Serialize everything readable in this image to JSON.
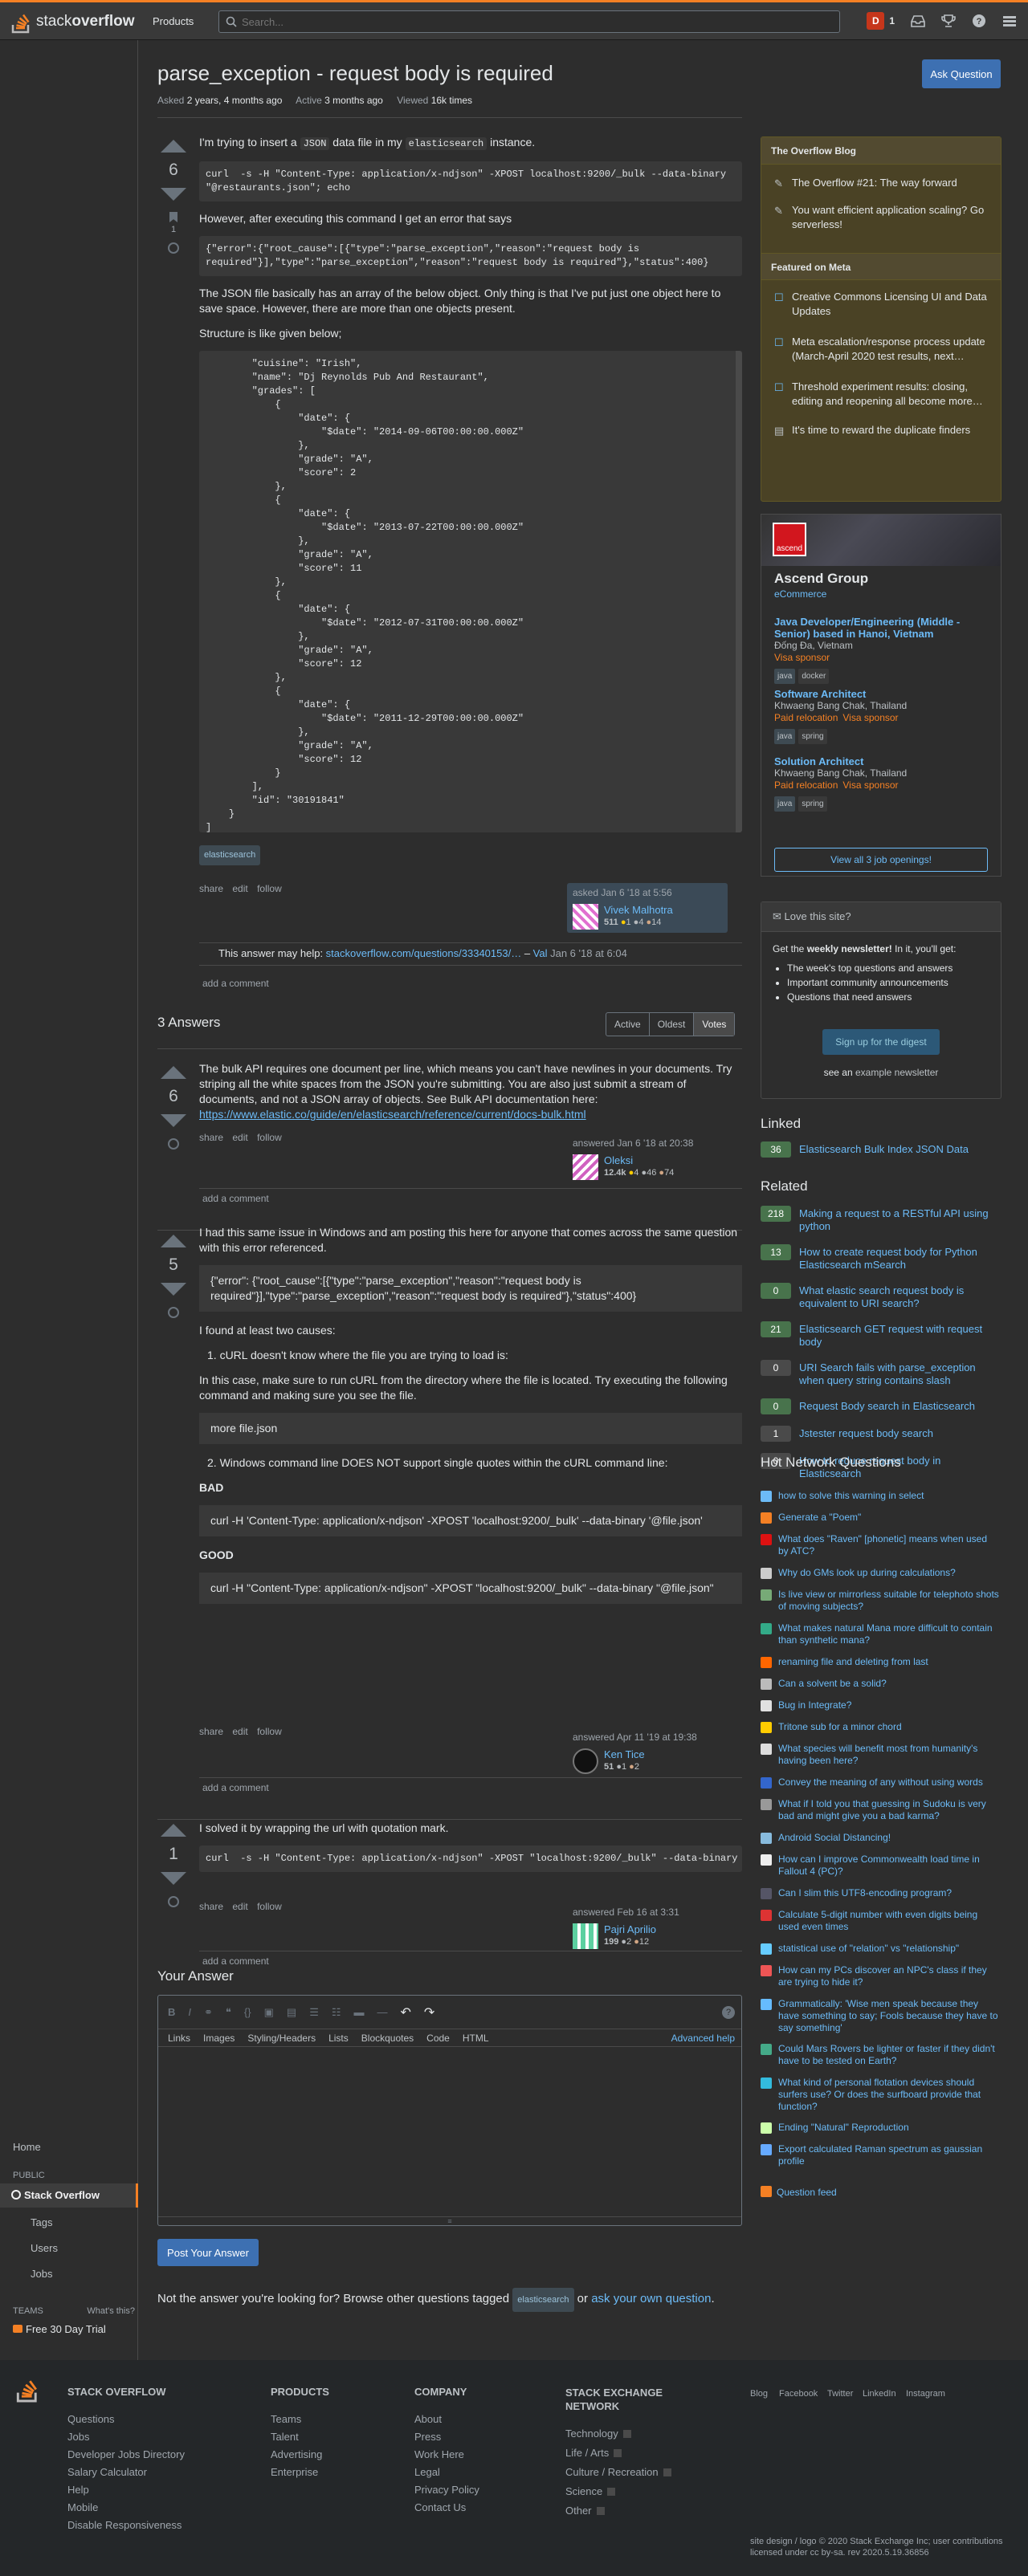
{
  "header": {
    "logo_text_a": "stack",
    "logo_text_b": "overflow",
    "products": "Products",
    "search_placeholder": "Search...",
    "user_initial": "D",
    "user_rep": "1"
  },
  "leftnav": {
    "home": "Home",
    "public": "PUBLIC",
    "stack_overflow": "Stack Overflow",
    "tags": "Tags",
    "users": "Users",
    "jobs": "Jobs",
    "teams": "TEAMS",
    "whats_this": "What's this?",
    "free_trial": "Free 30 Day Trial"
  },
  "question": {
    "title": "parse_exception - request body is required",
    "ask_button": "Ask Question",
    "asked_label": "Asked",
    "asked_value": "2 years, 4 months ago",
    "active_label": "Active",
    "active_value": "3 months ago",
    "viewed_label": "Viewed",
    "viewed_value": "16k times",
    "votes": "6",
    "bookmarks": "1",
    "p1_a": "I'm trying to insert a ",
    "p1_code": "JSON",
    "p1_b": " data file in my ",
    "p1_code2": "elasticsearch",
    "p1_c": " instance.",
    "cmd": "curl  -s -H \"Content-Type: application/x-ndjson\" -XPOST localhost:9200/_bulk --data-binary \"@restaurants.json\"; echo",
    "p2": "However, after executing this command I get an error that says",
    "err": "{\"error\":{\"root_cause\":[{\"type\":\"parse_exception\",\"reason\":\"request body is required\"}],\"type\":\"parse_exception\",\"reason\":\"request body is required\"},\"status\":400}",
    "p3": "The JSON file basically has an array of the below object. Only thing is that I've put just one object here to save space. However, there are more than one objects present.",
    "p4": "Structure is like given below;",
    "json": "        \"cuisine\": \"Irish\",\n        \"name\": \"Dj Reynolds Pub And Restaurant\",\n        \"grades\": [\n            {\n                \"date\": {\n                    \"$date\": \"2014-09-06T00:00:00.000Z\"\n                },\n                \"grade\": \"A\",\n                \"score\": 2\n            },\n            {\n                \"date\": {\n                    \"$date\": \"2013-07-22T00:00:00.000Z\"\n                },\n                \"grade\": \"A\",\n                \"score\": 11\n            },\n            {\n                \"date\": {\n                    \"$date\": \"2012-07-31T00:00:00.000Z\"\n                },\n                \"grade\": \"A\",\n                \"score\": 12\n            },\n            {\n                \"date\": {\n                    \"$date\": \"2011-12-29T00:00:00.000Z\"\n                },\n                \"grade\": \"A\",\n                \"score\": 12\n            }\n        ],\n        \"id\": \"30191841\"\n    }\n]",
    "tag": "elasticsearch",
    "share": "share",
    "edit": "edit",
    "follow": "follow",
    "asked_card": "asked Jan 6 '18 at 5:56",
    "user": "Vivek Malhotra",
    "rep": "511",
    "gold": "1",
    "silver": "4",
    "bronze": "14",
    "comment_text": "This answer may help: ",
    "comment_link": "stackoverflow.com/questions/33340153/…",
    "comment_sep": " – ",
    "comment_user": "Val",
    "comment_date": " Jan 6 '18 at 6:04",
    "add_comment": "add a comment"
  },
  "answers": {
    "count_label": "3 Answers",
    "sort_active": "Active",
    "sort_oldest": "Oldest",
    "sort_votes": "Votes",
    "a1": {
      "votes": "6",
      "text": "The bulk API requires one document per line, which means you can't have newlines in your documents. Try striping all the white spaces from the JSON you're submitting. You are also just submit a stream of documents, and not a JSON array of objects. See Bulk API documentation here: ",
      "link": "https://www.elastic.co/guide/en/elasticsearch/reference/current/docs-bulk.html",
      "card": "answered Jan 6 '18 at 20:38",
      "user": "Oleksi",
      "rep": "12.4k",
      "gold": "4",
      "silver": "46",
      "bronze": "74"
    },
    "a2": {
      "votes": "5",
      "intro": "I had this same issue in Windows and am posting this here for anyone that comes across the same question with this error referenced.",
      "err": "{\"error\": {\"root_cause\":[{\"type\":\"parse_exception\",\"reason\":\"request body is required\"}],\"type\":\"parse_exception\",\"reason\":\"request body is required\"},\"status\":400}",
      "causes": "I found at least two causes:",
      "c1": "1.  cURL doesn't know where the file you are trying to load is:",
      "c1_text": "In this case, make sure to run cURL from the directory where the file is located. Try executing the following command and making sure you see the file.",
      "cmd1": "more file.json",
      "c2": "2.  Windows command line DOES NOT support single quotes within the cURL command line:",
      "bad": "BAD",
      "bad_cmd": "curl -H 'Content-Type: application/x-ndjson' -XPOST 'localhost:9200/_bulk' --data-binary '@file.json'",
      "good": "GOOD",
      "good_cmd": "curl -H \"Content-Type: application/x-ndjson\" -XPOST \"localhost:9200/_bulk\" --data-binary \"@file.json\"",
      "card": "answered Apr 11 '19 at 19:38",
      "user": "Ken Tice",
      "rep": "51",
      "silver": "1",
      "bronze": "2"
    },
    "a3": {
      "votes": "1",
      "text": "I solved it by wrapping the url with quotation mark.",
      "cmd": "curl  -s -H \"Content-Type: application/x-ndjson\" -XPOST \"localhost:9200/_bulk\" --data-binary",
      "card": "answered Feb 16 at 3:31",
      "user": "Pajri Aprilio",
      "rep": "199",
      "silver": "2",
      "bronze": "12"
    }
  },
  "your_answer": {
    "title": "Your Answer",
    "tab_links": "Links",
    "tab_images": "Images",
    "tab_styling": "Styling/Headers",
    "tab_lists": "Lists",
    "tab_blockquotes": "Blockquotes",
    "tab_code": "Code",
    "tab_html": "HTML",
    "advanced": "Advanced help",
    "post_button": "Post Your Answer",
    "browse_a": "Not the answer you're looking for? Browse other questions tagged ",
    "browse_tag": "elasticsearch",
    "browse_or": " or ",
    "browse_link": "ask your own question",
    "browse_end": "."
  },
  "sidebar": {
    "blog_header": "The Overflow Blog",
    "blog1": "The Overflow #21: The way forward",
    "blog2": "You want efficient application scaling? Go serverless!",
    "meta_header": "Featured on Meta",
    "meta1": "Creative Commons Licensing UI and Data Updates",
    "meta2": "Meta escalation/response process update (March-April 2020 test results, next…",
    "meta3": "Threshold experiment results: closing, editing and reopening all become more…",
    "meta4": "It's time to reward the duplicate finders",
    "company": "Ascend Group",
    "company_sub": "eCommerce",
    "brand": "ascend",
    "jobs": [
      {
        "title": "Java Developer/Engineering (Middle - Senior) based in Hanoi, Vietnam",
        "loc": "Đống Đa, Vietnam",
        "perk": "Visa sponsor",
        "tags": [
          "java",
          "docker"
        ]
      },
      {
        "title": "Software Architect",
        "loc": "Khwaeng Bang Chak, Thailand",
        "perk": "Paid relocation",
        "perk2": "Visa sponsor",
        "tags": [
          "java",
          "spring"
        ]
      },
      {
        "title": "Solution Architect",
        "loc": "Khwaeng Bang Chak, Thailand",
        "perk": "Paid relocation",
        "perk2": "Visa sponsor",
        "tags": [
          "java",
          "spring"
        ]
      }
    ],
    "view_jobs": "View all 3 job openings!",
    "news_title": "Love this site?",
    "news_text_a": "Get the ",
    "news_text_b": "weekly newsletter!",
    "news_text_c": " In it, you'll get:",
    "news_items": [
      "The week's top questions and answers",
      "Important community announcements",
      "Questions that need answers"
    ],
    "news_button": "Sign up for the digest",
    "see_an": "see an ",
    "example": "example newsletter",
    "linked": "Linked",
    "linked_items": [
      {
        "score": "36",
        "title": "Elasticsearch Bulk Index JSON Data",
        "acc": true
      }
    ],
    "related": "Related",
    "related_items": [
      {
        "score": "218",
        "title": "Making a request to a RESTful API using python",
        "acc": true
      },
      {
        "score": "13",
        "title": "How to create request body for Python Elasticsearch mSearch",
        "acc": true
      },
      {
        "score": "0",
        "title": "What elastic search request body is equivalent to URI search?",
        "acc": true
      },
      {
        "score": "21",
        "title": "Elasticsearch GET request with request body",
        "acc": true
      },
      {
        "score": "0",
        "title": "URI Search fails with parse_exception when query string contains slash",
        "acc": false
      },
      {
        "score": "0",
        "title": "Request Body search in Elasticsearch",
        "acc": true
      },
      {
        "score": "1",
        "title": "Jstester request body search",
        "acc": false
      },
      {
        "score": "0",
        "title": "How to reduce request body in Elasticsearch",
        "acc": false
      }
    ],
    "hnq": "Hot Network Questions",
    "hnq_items": [
      "how to solve this warning in select",
      "Generate a \"Poem\"",
      "What does \"Raven\" [phonetic] means when used by ATC?",
      "Why do GMs look up during calculations?",
      "Is live view or mirrorless suitable for telephoto shots of moving subjects?",
      "What makes natural Mana more difficult to contain than synthetic mana?",
      "renaming file and deleting from last",
      "Can a solvent be a solid?",
      "Bug in Integrate?",
      "Tritone sub for a minor chord",
      "What species will benefit most from humanity's having been here?",
      "Convey the meaning of any without using words",
      "What if I told you that guessing in Sudoku is very bad and might give you a bad karma?",
      "Android Social Distancing!",
      "How can I improve Commonwealth load time in Fallout 4 (PC)?",
      "Can I slim this UTF8-encoding program?",
      "Calculate 5-digit number with even digits being used even times",
      "statistical use of \"relation\" vs \"relationship\"",
      "How can my PCs discover an NPC's class if they are trying to hide it?",
      "Grammatically: 'Wise men speak because they have something to say; Fools because they have to say something'",
      "Could Mars Rovers be lighter or faster if they didn't have to be tested on Earth?",
      "What kind of personal flotation devices should surfers use? Or does the surfboard provide that function?",
      "Ending \"Natural\" Reproduction",
      "Export calculated Raman spectrum as gaussian profile"
    ],
    "feed": "Question feed"
  },
  "footer": {
    "so": "STACK OVERFLOW",
    "so_links": [
      "Questions",
      "Jobs",
      "Developer Jobs Directory",
      "Salary Calculator",
      "Help",
      "Mobile",
      "Disable Responsiveness"
    ],
    "products": "PRODUCTS",
    "prod_links": [
      "Teams",
      "Talent",
      "Advertising",
      "Enterprise"
    ],
    "company": "COMPANY",
    "comp_links": [
      "About",
      "Press",
      "Work Here",
      "Legal",
      "Privacy Policy",
      "Contact Us"
    ],
    "sen": "STACK EXCHANGE NETWORK",
    "sen_links": [
      "Technology",
      "Life / Arts",
      "Culture / Recreation",
      "Science",
      "Other"
    ],
    "social": [
      "Blog",
      "Facebook",
      "Twitter",
      "LinkedIn",
      "Instagram"
    ],
    "copy1": "site design / logo © 2020 Stack Exchange Inc; user contributions",
    "copy2": "licensed under cc by-sa. rev 2020.5.19.36856"
  },
  "colors": {
    "accent": "#f48024",
    "link": "#6cbbf7",
    "accepted": "#48734c",
    "blog_bg": "#4a4225"
  }
}
